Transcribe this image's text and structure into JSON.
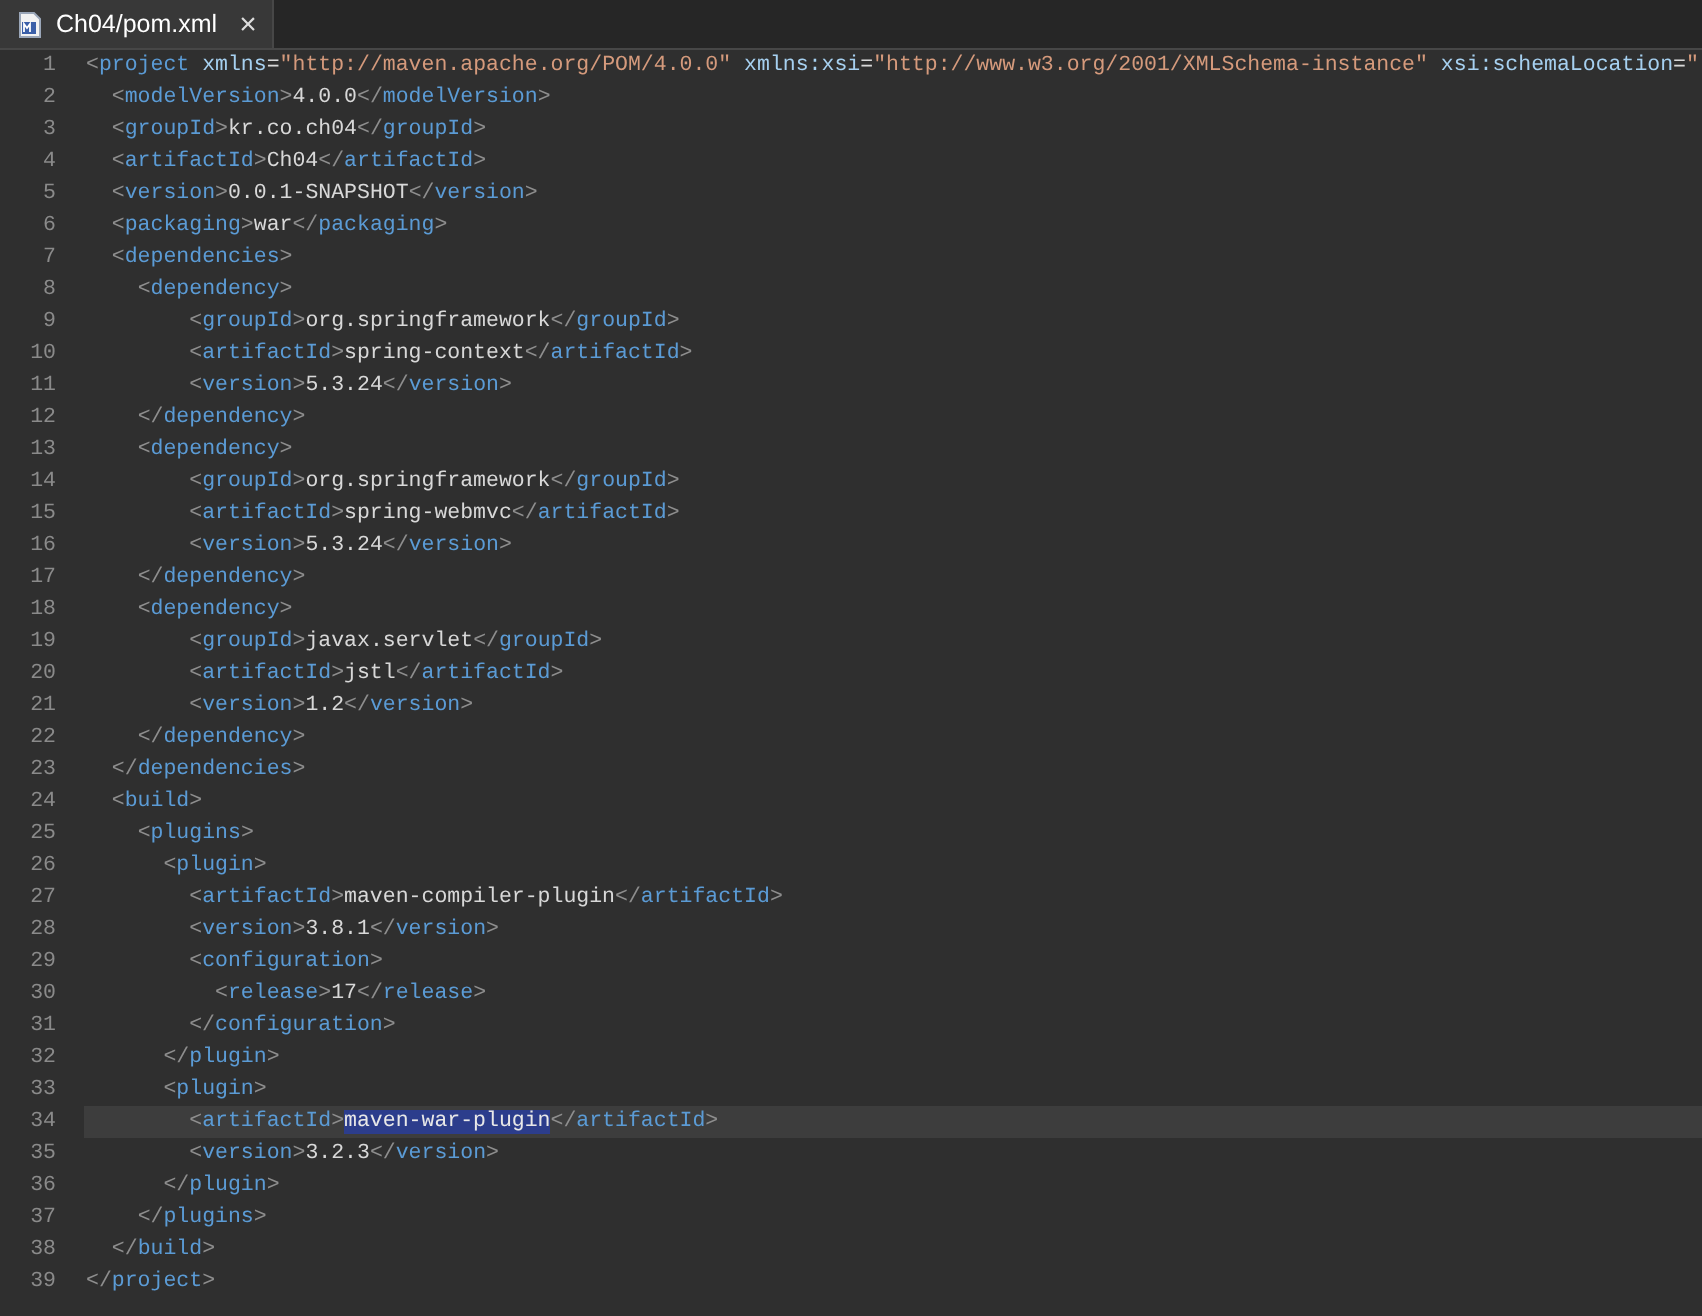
{
  "tab": {
    "title": "Ch04/pom.xml",
    "close": "×",
    "selected": true
  },
  "lines": [
    {
      "number": "1",
      "current": false,
      "code": "<project xmlns=\"http://maven.apache.org/POM/4.0.0\" xmlns:xsi=\"http://www.w3.org/2001/XMLSchema-instance\" xsi:schemaLocation=\""
    },
    {
      "number": "2",
      "current": false,
      "code": "  <modelVersion>4.0.0</modelVersion>"
    },
    {
      "number": "3",
      "current": false,
      "code": "  <groupId>kr.co.ch04</groupId>"
    },
    {
      "number": "4",
      "current": false,
      "code": "  <artifactId>Ch04</artifactId>"
    },
    {
      "number": "5",
      "current": false,
      "code": "  <version>0.0.1-SNAPSHOT</version>"
    },
    {
      "number": "6",
      "current": false,
      "code": "  <packaging>war</packaging>"
    },
    {
      "number": "7",
      "current": false,
      "code": "  <dependencies>"
    },
    {
      "number": "8",
      "current": false,
      "code": "    <dependency>"
    },
    {
      "number": "9",
      "current": false,
      "code": "        <groupId>org.springframework</groupId>"
    },
    {
      "number": "10",
      "current": false,
      "code": "        <artifactId>spring-context</artifactId>"
    },
    {
      "number": "11",
      "current": false,
      "code": "        <version>5.3.24</version>"
    },
    {
      "number": "12",
      "current": false,
      "code": "    </dependency>"
    },
    {
      "number": "13",
      "current": false,
      "code": "    <dependency>"
    },
    {
      "number": "14",
      "current": false,
      "code": "        <groupId>org.springframework</groupId>"
    },
    {
      "number": "15",
      "current": false,
      "code": "        <artifactId>spring-webmvc</artifactId>"
    },
    {
      "number": "16",
      "current": false,
      "code": "        <version>5.3.24</version>"
    },
    {
      "number": "17",
      "current": false,
      "code": "    </dependency>"
    },
    {
      "number": "18",
      "current": false,
      "code": "    <dependency>"
    },
    {
      "number": "19",
      "current": false,
      "code": "        <groupId>javax.servlet</groupId>"
    },
    {
      "number": "20",
      "current": false,
      "code": "        <artifactId>jstl</artifactId>"
    },
    {
      "number": "21",
      "current": false,
      "code": "        <version>1.2</version>"
    },
    {
      "number": "22",
      "current": false,
      "code": "    </dependency>"
    },
    {
      "number": "23",
      "current": false,
      "code": "  </dependencies>"
    },
    {
      "number": "24",
      "current": false,
      "code": "  <build>"
    },
    {
      "number": "25",
      "current": false,
      "code": "    <plugins>"
    },
    {
      "number": "26",
      "current": false,
      "code": "      <plugin>"
    },
    {
      "number": "27",
      "current": false,
      "code": "        <artifactId>maven-compiler-plugin</artifactId>"
    },
    {
      "number": "28",
      "current": false,
      "code": "        <version>3.8.1</version>"
    },
    {
      "number": "29",
      "current": false,
      "code": "        <configuration>"
    },
    {
      "number": "30",
      "current": false,
      "code": "          <release>17</release>"
    },
    {
      "number": "31",
      "current": false,
      "code": "        </configuration>"
    },
    {
      "number": "32",
      "current": false,
      "code": "      </plugin>"
    },
    {
      "number": "33",
      "current": false,
      "code": "      <plugin>"
    },
    {
      "number": "34",
      "current": true,
      "code": "        <artifactId>",
      "selection": "maven-war-plugin",
      "code_after": "</artifactId>"
    },
    {
      "number": "35",
      "current": false,
      "code": "        <version>3.2.3</version>"
    },
    {
      "number": "36",
      "current": false,
      "code": "      </plugin>"
    },
    {
      "number": "37",
      "current": false,
      "code": "    </plugins>"
    },
    {
      "number": "38",
      "current": false,
      "code": "  </build>"
    },
    {
      "number": "39",
      "current": false,
      "code": "</project>"
    }
  ]
}
